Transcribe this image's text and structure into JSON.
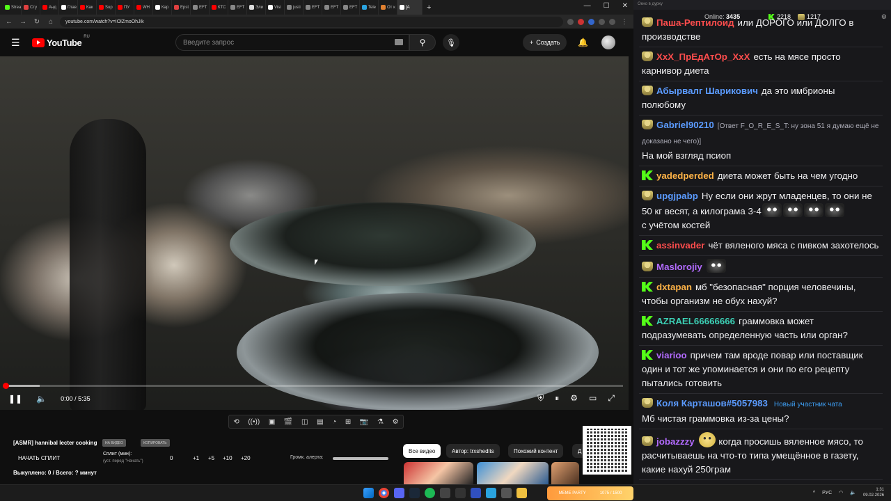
{
  "browser": {
    "tabs": [
      {
        "label": "Strea",
        "color": "#53fc18"
      },
      {
        "label": "Сту",
        "color": "#e04040"
      },
      {
        "label": "Анд",
        "color": "#ff0000"
      },
      {
        "label": "Глав",
        "color": "#ffffff"
      },
      {
        "label": "Как",
        "color": "#ff0000"
      },
      {
        "label": "Sup",
        "color": "#ff0000"
      },
      {
        "label": "ПУ",
        "color": "#ff0000"
      },
      {
        "label": "WH",
        "color": "#ff0000"
      },
      {
        "label": "Кар",
        "color": "#ffffff"
      },
      {
        "label": "Epst",
        "color": "#e04040"
      },
      {
        "label": "EFT",
        "color": "#888888"
      },
      {
        "label": "КТС",
        "color": "#ff0000"
      },
      {
        "label": "EFT",
        "color": "#888888"
      },
      {
        "label": "Эли",
        "color": "#dddddd"
      },
      {
        "label": "Visi",
        "color": "#ffffff"
      },
      {
        "label": "justi",
        "color": "#888888"
      },
      {
        "label": "EFT",
        "color": "#888888"
      },
      {
        "label": "EFT",
        "color": "#888888"
      },
      {
        "label": "EFT",
        "color": "#888888"
      },
      {
        "label": "Tele",
        "color": "#2aa3df"
      },
      {
        "label": "От к",
        "color": "#e08030"
      },
      {
        "label": "[A",
        "color": "#ffffff"
      }
    ],
    "new_tab": "+",
    "url": "youtube.com/watch?v=IOlZmoOhJik"
  },
  "youtube": {
    "logo_text": "YouTube",
    "logo_region": "RU",
    "search_placeholder": "Введите запрос",
    "create_label": "Создать",
    "player": {
      "time": "0:00 / 5:35",
      "progress": 0.005,
      "buffered": 0.055
    },
    "video_title": "[ASMR] hannibal lecter cooking",
    "pill1": "НА ВИДЕО",
    "pill2": "КОПИРОВАТЬ",
    "start_split": "НАЧАТЬ СПЛИТ",
    "split_min": "Сплит (мин):",
    "split_hint": "(уст. перед \"Начать\")",
    "split_values": [
      "0",
      "+1",
      "+5",
      "+10",
      "+20"
    ],
    "alert_volume": "Громк. алерта:",
    "bought": "Выкуплено: 0 / Всего: ? минут",
    "chips": [
      "Все видео",
      "Автор: trxshedits",
      "Похожий контент",
      "Д"
    ]
  },
  "chat": {
    "window_title": "Окно в дурку",
    "online_label": "Online:",
    "online_count": "3435",
    "kick_count": "2218",
    "other_count": "1217",
    "messages": [
      {
        "badge": "h",
        "user": "Паша-Рептилоид",
        "color": "#ff4d4d",
        "text": "или ДОРОГО или ДОЛГО в производстве"
      },
      {
        "badge": "h",
        "user": "XxX_ПрЕдАтОр_XxX",
        "color": "#ff4d4d",
        "text": "есть на мясе просто карнивор диета"
      },
      {
        "badge": "h",
        "user": "Абырвалг Шарикович",
        "color": "#5b9bff",
        "text": "да это имбрионы полюбому"
      },
      {
        "badge": "h",
        "user": "Gabriel90210",
        "color": "#5b9bff",
        "reply": "[Ответ F_O_R_E_S_T: ну зона 51 я думаю ещё не доказано не чего)]",
        "text": "На мой взгляд псиоп"
      },
      {
        "badge": "k",
        "user": "yadedperded",
        "color": "#ffb347",
        "text": "диета может быть на чем угодно"
      },
      {
        "badge": "h",
        "user": "upgjpabp",
        "color": "#5b9bff",
        "text": "Ну если они жрут младенцев, то они не 50 кг весят, а килограма 3-4",
        "emotes": 4,
        "text2": "с учётом костей"
      },
      {
        "badge": "k",
        "user": "assinvader",
        "color": "#ff4d4d",
        "text": "чёт вяленого мяса с пивком захотелось"
      },
      {
        "badge": "h",
        "user": "Maslorojiy",
        "color": "#b36bff",
        "text": "",
        "emotes": 1
      },
      {
        "badge": "k",
        "user": "dxtapan",
        "color": "#ffb347",
        "text": "мб \"безопасная\" порция человечины, чтобы организм не обух нахуй?"
      },
      {
        "badge": "k",
        "user": "AZRAEL66666666",
        "color": "#3ccfb4",
        "text": "граммовка может подразумевать определенную часть или орган?"
      },
      {
        "badge": "k",
        "user": "viarioo",
        "color": "#b36bff",
        "text": "причем там вроде повар или поставщик один и тот же упоминается и они по его рецепту пытались готовить"
      },
      {
        "badge": "h",
        "user": "Коля Карташов#5057983",
        "color": "#5b9bff",
        "new": "Новый участник чата",
        "text": "Мб чистая граммовка из-за цены?"
      },
      {
        "badge": "h",
        "user": "jobazzzy",
        "color": "#b36bff",
        "smile": true,
        "text": "когда просишь вяленное мясо, то расчитываешь на что-то типа умещённое в газету, какие нахуй 250грам"
      }
    ]
  },
  "taskbar": {
    "widget_text": "МЕМЕ PARTY",
    "widget_count": "1075 / 1500",
    "lang": "РУС",
    "time": "1:31",
    "date": "09.02.2026"
  }
}
